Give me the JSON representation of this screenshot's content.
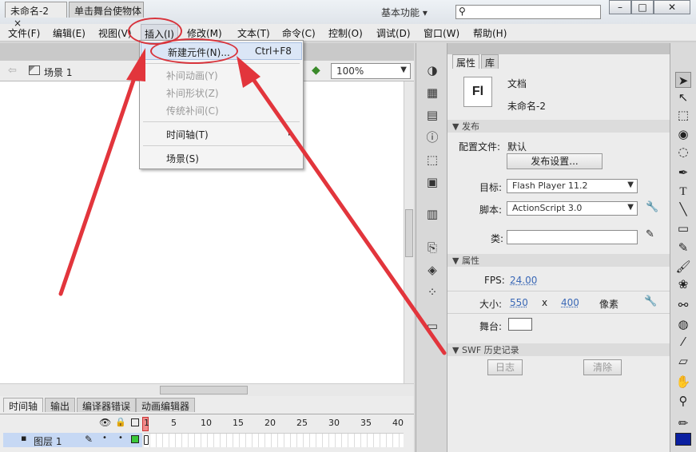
{
  "app": {
    "logo": "Fl",
    "workspace": "基本功能",
    "workspace_arrow": "▾",
    "search_icon": "⚲",
    "win_min": "–",
    "win_max": "□",
    "win_close": "✕"
  },
  "menu": [
    "文件(F)",
    "编辑(E)",
    "视图(V)",
    "插入(I)",
    "修改(M)",
    "文本(T)",
    "命令(C)",
    "控制(O)",
    "调试(D)",
    "窗口(W)",
    "帮助(H)"
  ],
  "doc_tabs": {
    "tab1": "未命名-2",
    "tab1_close": "×",
    "tab2": "单击舞台使物体"
  },
  "edit_bar": {
    "back": "⇦",
    "scene": "场景 1",
    "zoom": "100%"
  },
  "insert_menu": {
    "new_symbol": "新建元件(N)...",
    "new_symbol_shortcut": "Ctrl+F8",
    "motion_tween": "补间动画(Y)",
    "shape_tween": "补间形状(Z)",
    "classic_tween": "传统补间(C)",
    "timeline": "时间轴(T)",
    "timeline_arrow": "▸",
    "scene": "场景(S)"
  },
  "timeline": {
    "tabs": [
      "时间轴",
      "输出",
      "编译器错误",
      "动画编辑器"
    ],
    "frame_numbers": [
      "1",
      "5",
      "10",
      "15",
      "20",
      "25",
      "30",
      "35",
      "40"
    ],
    "layer_name": "图层 1"
  },
  "properties": {
    "tab_props": "属性",
    "tab_lib": "库",
    "doc_icon": "Fl",
    "doc_type": "文档",
    "doc_name": "未命名-2",
    "publish_header": "发布",
    "profile_label": "配置文件:",
    "profile_value": "默认",
    "publish_settings": "发布设置...",
    "target_label": "目标:",
    "target_value": "Flash Player 11.2",
    "script_label": "脚本:",
    "script_value": "ActionScript 3.0",
    "class_label": "类:",
    "props_header": "属性",
    "fps_label": "FPS:",
    "fps_value": "24.00",
    "size_label": "大小:",
    "width": "550",
    "x": "x",
    "height": "400",
    "unit": "像素",
    "stage_label": "舞台:",
    "history_header": "SWF 历史记录",
    "log_button": "日志",
    "clear_button": "清除"
  },
  "colors": {
    "accent_red": "#d8343c",
    "stage_color": "#ffffff",
    "fill_color": "#0a1fa0",
    "layer_highlight": "#c6d8f4"
  }
}
